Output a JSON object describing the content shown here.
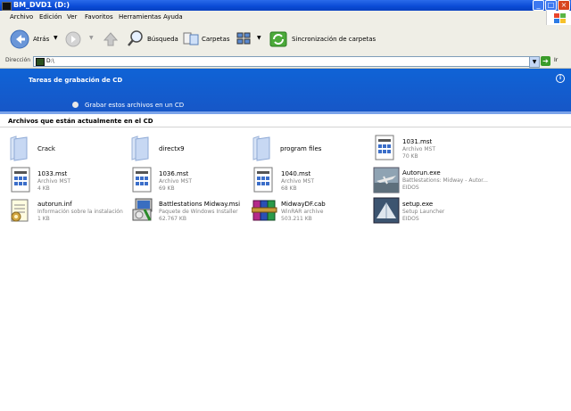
{
  "window": {
    "title": "BM_DVD1 (D:)"
  },
  "menu": [
    "Archivo",
    "Edición",
    "Ver",
    "Favoritos",
    "Herramientas",
    "Ayuda"
  ],
  "toolbar": {
    "back_label": "Atrás",
    "search_label": "Búsqueda",
    "folders_label": "Carpetas",
    "sync_label": "Sincronización de carpetas"
  },
  "address": {
    "label": "Dirección",
    "value": "D:\\",
    "go_label": "Ir"
  },
  "cd_tasks": {
    "title": "Tareas de grabación de CD",
    "burn_link": "Grabar estos archivos en un CD"
  },
  "section": {
    "title": "Archivos que están actualmente en el CD"
  },
  "files": [
    {
      "name": "Crack",
      "icon": "folder-icon",
      "l1": "",
      "l2": ""
    },
    {
      "name": "directx9",
      "icon": "folder-icon",
      "l1": "",
      "l2": ""
    },
    {
      "name": "program files",
      "icon": "folder-icon",
      "l1": "",
      "l2": ""
    },
    {
      "name": "1031.mst",
      "icon": "mst-file-icon",
      "l1": "Archivo MST",
      "l2": "70 KB"
    },
    {
      "name": "1033.mst",
      "icon": "mst-file-icon",
      "l1": "Archivo MST",
      "l2": "4 KB"
    },
    {
      "name": "1036.mst",
      "icon": "mst-file-icon",
      "l1": "Archivo MST",
      "l2": "69 KB"
    },
    {
      "name": "1040.mst",
      "icon": "mst-file-icon",
      "l1": "Archivo MST",
      "l2": "68 KB"
    },
    {
      "name": "Autorun.exe",
      "icon": "autorun-exe-icon",
      "l1": "Battlestations: Midway - Autor...",
      "l2": "EIDOS"
    },
    {
      "name": "autorun.inf",
      "icon": "inf-file-icon",
      "l1": "Información sobre la instalación",
      "l2": "1 KB"
    },
    {
      "name": "Battlestations Midway.msi",
      "icon": "msi-installer-icon",
      "l1": "Paquete de Windows Installer",
      "l2": "62.767 KB"
    },
    {
      "name": "MidwayDF.cab",
      "icon": "winrar-archive-icon",
      "l1": "WinRAR archive",
      "l2": "503.211 KB"
    },
    {
      "name": "setup.exe",
      "icon": "setup-exe-icon",
      "l1": "Setup Launcher",
      "l2": "EIDOS"
    }
  ],
  "colors": {
    "title_bar": "#0a4bd6",
    "cd_panel": "#1358cf",
    "chrome": "#efeee6",
    "folder": "#b8cdf0"
  }
}
